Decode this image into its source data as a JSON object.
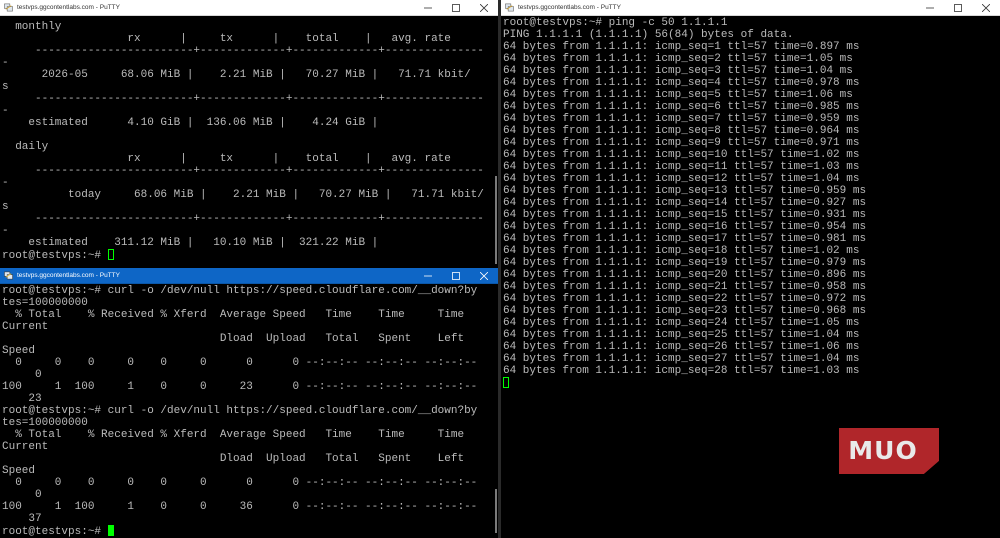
{
  "windows": {
    "top_left": {
      "title": "testvps.ggcontentlabs.com - PuTTY",
      "lines": [
        "  monthly",
        "                   rx      |     tx      |    total    |   avg. rate",
        "     ------------------------+-------------+-------------+---------------",
        "-",
        "      2026-05     68.06 MiB |    2.21 MiB |   70.27 MiB |   71.71 kbit/",
        "s",
        "     ------------------------+-------------+-------------+---------------",
        "-",
        "    estimated      4.10 GiB |  136.06 MiB |    4.24 GiB |",
        "",
        "  daily",
        "                   rx      |     tx      |    total    |   avg. rate",
        "     ------------------------+-------------+-------------+---------------",
        "-",
        "          today     68.06 MiB |    2.21 MiB |   70.27 MiB |   71.71 kbit/",
        "s",
        "     ------------------------+-------------+-------------+---------------",
        "-",
        "    estimated    311.12 MiB |   10.10 MiB |  321.22 MiB |"
      ],
      "prompt": "root@testvps:~# "
    },
    "bottom_left": {
      "title": "testvps.ggcontentlabs.com - PuTTY",
      "lines": [
        "root@testvps:~# curl -o /dev/null https://speed.cloudflare.com/__down?by",
        "tes=100000000",
        "  % Total    % Received % Xferd  Average Speed   Time    Time     Time",
        "Current",
        "                                 Dload  Upload   Total   Spent    Left",
        "Speed",
        "  0     0    0     0    0     0      0      0 --:--:-- --:--:-- --:--:--",
        "     0",
        "100     1  100     1    0     0     23      0 --:--:-- --:--:-- --:--:--",
        "    23",
        "root@testvps:~# curl -o /dev/null https://speed.cloudflare.com/__down?by",
        "tes=100000000",
        "  % Total    % Received % Xferd  Average Speed   Time    Time     Time",
        "Current",
        "                                 Dload  Upload   Total   Spent    Left",
        "Speed",
        "  0     0    0     0    0     0      0      0 --:--:-- --:--:-- --:--:--",
        "     0",
        "100     1  100     1    0     0     36      0 --:--:-- --:--:-- --:--:--",
        "    37"
      ],
      "prompt": "root@testvps:~# "
    },
    "right": {
      "title": "testvps.ggcontentlabs.com - PuTTY",
      "lines": [
        "root@testvps:~# ping -c 50 1.1.1.1",
        "PING 1.1.1.1 (1.1.1.1) 56(84) bytes of data.",
        "64 bytes from 1.1.1.1: icmp_seq=1 ttl=57 time=0.897 ms",
        "64 bytes from 1.1.1.1: icmp_seq=2 ttl=57 time=1.05 ms",
        "64 bytes from 1.1.1.1: icmp_seq=3 ttl=57 time=1.04 ms",
        "64 bytes from 1.1.1.1: icmp_seq=4 ttl=57 time=0.978 ms",
        "64 bytes from 1.1.1.1: icmp_seq=5 ttl=57 time=1.06 ms",
        "64 bytes from 1.1.1.1: icmp_seq=6 ttl=57 time=0.985 ms",
        "64 bytes from 1.1.1.1: icmp_seq=7 ttl=57 time=0.959 ms",
        "64 bytes from 1.1.1.1: icmp_seq=8 ttl=57 time=0.964 ms",
        "64 bytes from 1.1.1.1: icmp_seq=9 ttl=57 time=0.971 ms",
        "64 bytes from 1.1.1.1: icmp_seq=10 ttl=57 time=1.02 ms",
        "64 bytes from 1.1.1.1: icmp_seq=11 ttl=57 time=1.03 ms",
        "64 bytes from 1.1.1.1: icmp_seq=12 ttl=57 time=1.04 ms",
        "64 bytes from 1.1.1.1: icmp_seq=13 ttl=57 time=0.959 ms",
        "64 bytes from 1.1.1.1: icmp_seq=14 ttl=57 time=0.927 ms",
        "64 bytes from 1.1.1.1: icmp_seq=15 ttl=57 time=0.931 ms",
        "64 bytes from 1.1.1.1: icmp_seq=16 ttl=57 time=0.954 ms",
        "64 bytes from 1.1.1.1: icmp_seq=17 ttl=57 time=0.981 ms",
        "64 bytes from 1.1.1.1: icmp_seq=18 ttl=57 time=1.02 ms",
        "64 bytes from 1.1.1.1: icmp_seq=19 ttl=57 time=0.979 ms",
        "64 bytes from 1.1.1.1: icmp_seq=20 ttl=57 time=0.896 ms",
        "64 bytes from 1.1.1.1: icmp_seq=21 ttl=57 time=0.958 ms",
        "64 bytes from 1.1.1.1: icmp_seq=22 ttl=57 time=0.972 ms",
        "64 bytes from 1.1.1.1: icmp_seq=23 ttl=57 time=0.968 ms",
        "64 bytes from 1.1.1.1: icmp_seq=24 ttl=57 time=1.05 ms",
        "64 bytes from 1.1.1.1: icmp_seq=25 ttl=57 time=1.04 ms",
        "64 bytes from 1.1.1.1: icmp_seq=26 ttl=57 time=1.06 ms",
        "64 bytes from 1.1.1.1: icmp_seq=27 ttl=57 time=1.04 ms",
        "64 bytes from 1.1.1.1: icmp_seq=28 ttl=57 time=1.03 ms"
      ]
    }
  },
  "logo": {
    "text": "MUO"
  },
  "colors": {
    "terminal_bg": "#000000",
    "terminal_fg": "#bbbbbb",
    "cursor": "#00ff00",
    "active_title": "#0e66c6",
    "logo_red": "#b0262a"
  },
  "icons": {
    "app": "putty-icon",
    "minimize": "minimize-icon",
    "maximize": "maximize-icon",
    "close": "close-icon"
  }
}
